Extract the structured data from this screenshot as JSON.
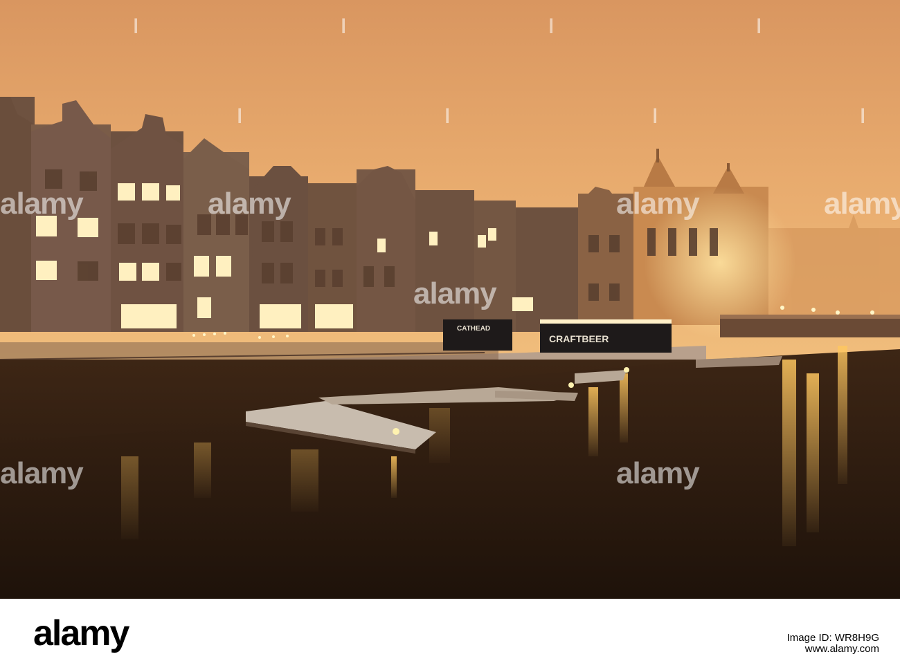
{
  "image": {
    "description_colors": {
      "sky": "#e2a46a",
      "water": "#2a1a10",
      "building": "#7a5a45",
      "light": "#ffd77a"
    }
  },
  "signs": {
    "cathead": "CATHEAD",
    "craftbeer": "CRAFTBEER"
  },
  "watermark": {
    "text": "alamy"
  },
  "footer": {
    "logo": "alamy",
    "image_id": "Image ID: WR8H9G",
    "site": "www.alamy.com"
  }
}
